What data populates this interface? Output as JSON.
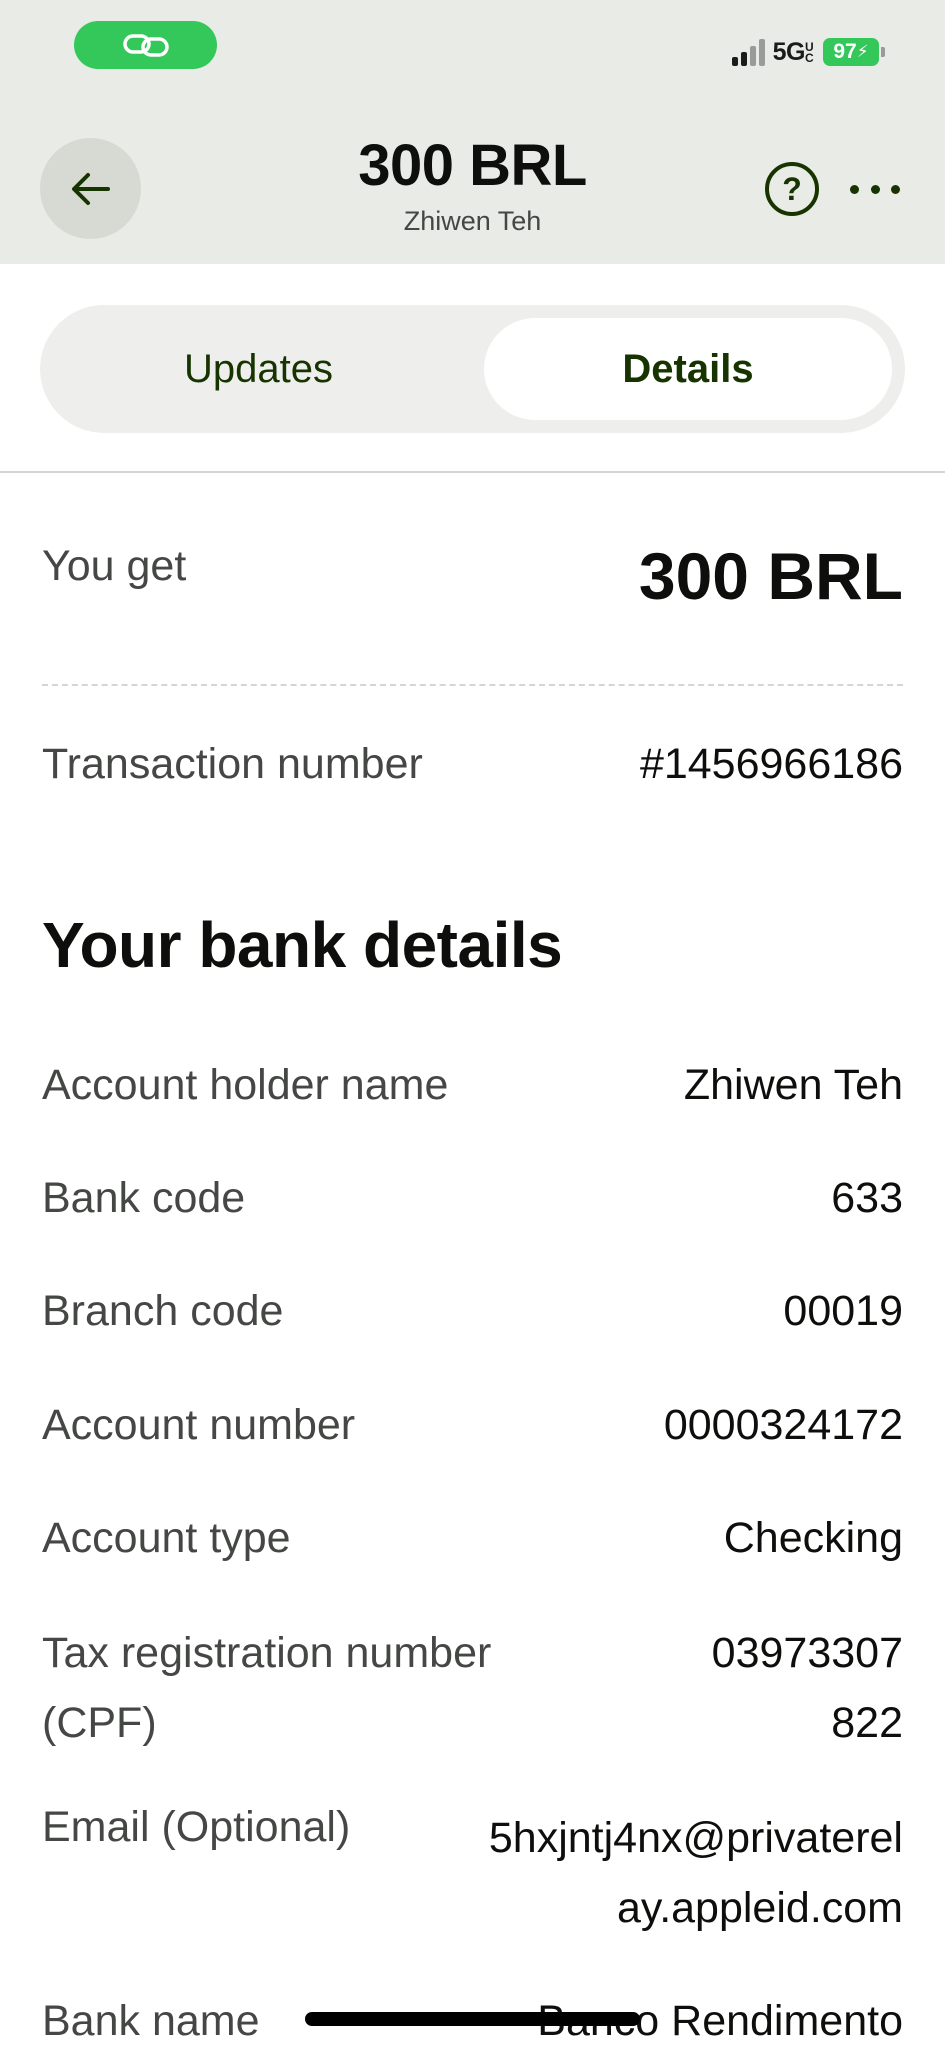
{
  "status_bar": {
    "network": "5G",
    "network_suffix": "UC",
    "battery": "97",
    "colors": {
      "call_pill": "#34c759",
      "battery": "#34c759"
    }
  },
  "header": {
    "title": "300 BRL",
    "subtitle": "Zhiwen Teh",
    "back_icon": "arrow-left-icon",
    "help_icon": "question-circle-icon",
    "more_icon": "ellipsis-icon"
  },
  "tabs": [
    {
      "label": "Updates",
      "selected": false
    },
    {
      "label": "Details",
      "selected": true
    }
  ],
  "summary": {
    "you_get_label": "You get",
    "you_get_value": "300 BRL",
    "transaction_label": "Transaction number",
    "transaction_value": "#1456966186"
  },
  "bank_details": {
    "title": "Your bank details",
    "rows": [
      {
        "label": "Account holder name",
        "value": "Zhiwen Teh"
      },
      {
        "label": "Bank code",
        "value": "633"
      },
      {
        "label": "Branch code",
        "value": "00019"
      },
      {
        "label": "Account number",
        "value": "0000324172"
      },
      {
        "label": "Account type",
        "value": "Checking"
      },
      {
        "label_line1": "Tax registration number",
        "label_line2": "(CPF)",
        "value_line1": "03973307",
        "value_line2": "822"
      },
      {
        "label": "Email (Optional)",
        "value_line1": "5hxjntj4nx@privaterel",
        "value_line2": "ay.appleid.com"
      },
      {
        "label": "Bank name",
        "value": "Banco Rendimento"
      }
    ]
  },
  "colors": {
    "header_bg": "#e8ebe6",
    "accent_dark_green": "#163300",
    "tabs_bg": "#eeefed",
    "label_gray": "#454745"
  }
}
